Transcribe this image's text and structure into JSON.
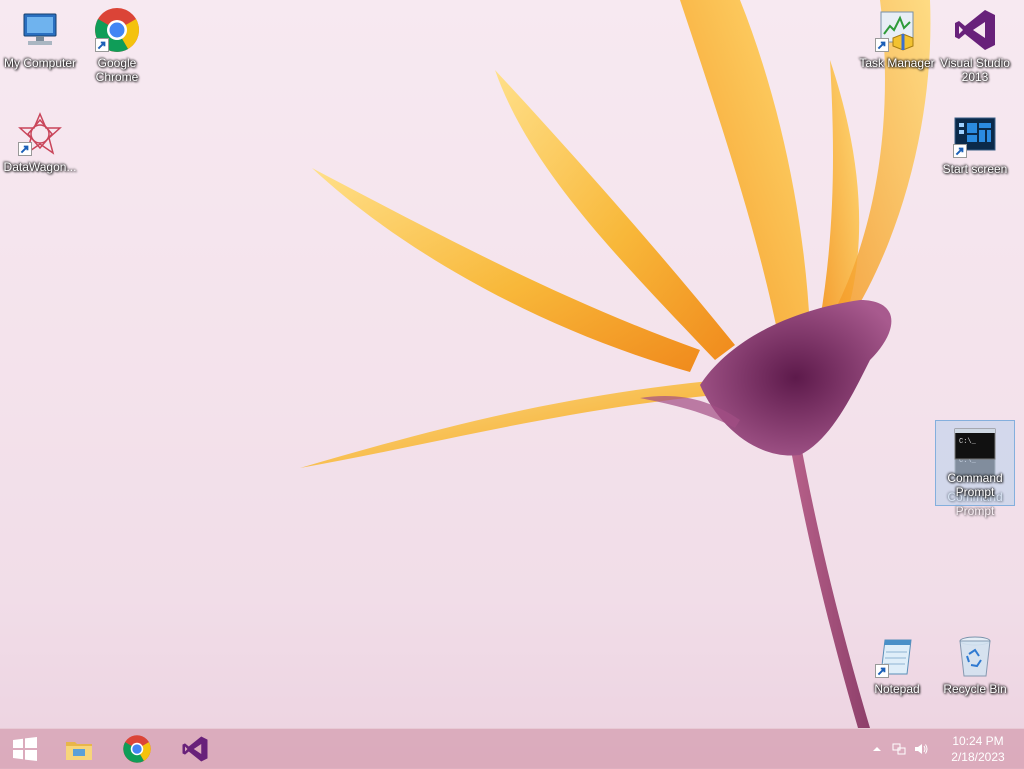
{
  "desktop": {
    "icons": {
      "my_computer": "My Computer",
      "google_chrome": "Google Chrome",
      "datawagon": "DataWagon...",
      "task_manager": "Task Manager",
      "visual_studio": "Visual Studio 2013",
      "start_screen": "Start screen",
      "command_prompt": "Command Prompt",
      "command_prompt_ghost": "Command Prompt",
      "notepad": "Notepad",
      "recycle_bin": "Recycle Bin"
    }
  },
  "taskbar": {
    "pinned": [
      "file-explorer",
      "google-chrome",
      "visual-studio"
    ],
    "clock": {
      "time": "10:24 PM",
      "date": "2/18/2023"
    }
  },
  "colors": {
    "petal": "#f6b335",
    "flower_center": "#7b2a63",
    "taskbar": "#d6a0b2",
    "vs_purple": "#68217a"
  }
}
